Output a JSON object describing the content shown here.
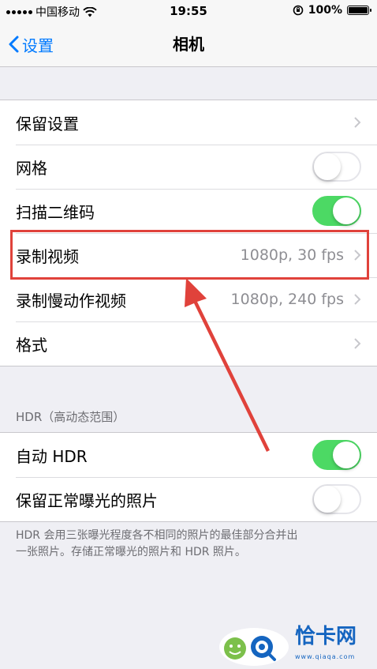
{
  "status_bar": {
    "carrier": "中国移动",
    "time": "19:55",
    "battery": "100%",
    "battery_level": 1.0
  },
  "nav": {
    "back_label": "设置",
    "title": "相机"
  },
  "group1": [
    {
      "label": "保留设置",
      "type": "chevron"
    },
    {
      "label": "网格",
      "type": "toggle",
      "on": false
    },
    {
      "label": "扫描二维码",
      "type": "toggle",
      "on": true
    },
    {
      "label": "录制视频",
      "type": "chevron",
      "value": "1080p, 30 fps"
    },
    {
      "label": "录制慢动作视频",
      "type": "chevron",
      "value": "1080p, 240 fps"
    },
    {
      "label": "格式",
      "type": "chevron"
    }
  ],
  "hdr_section": {
    "header": "HDR（高动态范围）",
    "rows": [
      {
        "label": "自动 HDR",
        "type": "toggle",
        "on": true
      },
      {
        "label": "保留正常曝光的照片",
        "type": "toggle",
        "on": false
      }
    ],
    "footer_line1": "HDR 会用三张曝光程度各不相同的照片的最佳部分合并出",
    "footer_line2": "一张照片。存储正常曝光的照片和 HDR 照片。"
  },
  "annotation": {
    "highlight_color": "#e0423b"
  },
  "watermark": {
    "text": "恰卡网",
    "sub": "www.qiaqa.com"
  },
  "colors": {
    "accent": "#007aff",
    "toggle_on": "#4cd964"
  }
}
